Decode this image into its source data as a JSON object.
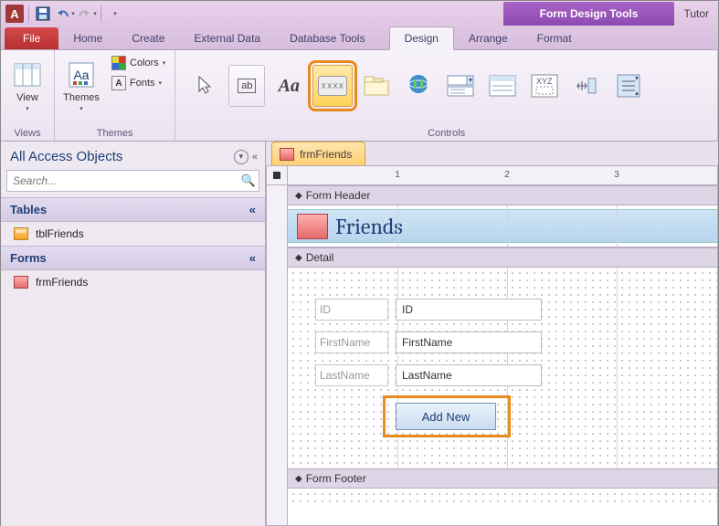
{
  "titlebar": {
    "app_letter": "A",
    "context_title": "Form Design Tools",
    "right_text": "Tutor"
  },
  "tabs": {
    "file": "File",
    "items": [
      "Home",
      "Create",
      "External Data",
      "Database Tools"
    ],
    "context": [
      "Design",
      "Arrange",
      "Format"
    ],
    "active_context_index": 0
  },
  "ribbon": {
    "views": {
      "label": "Views",
      "btn": "View"
    },
    "themes": {
      "label": "Themes",
      "btn": "Themes",
      "colors": "Colors",
      "fonts": "Fonts"
    },
    "controls": {
      "label": "Controls",
      "xxxx": "XXXX",
      "ab": "ab",
      "Aa": "Aa"
    }
  },
  "nav": {
    "title": "All Access Objects",
    "search_placeholder": "Search...",
    "sections": [
      {
        "name": "Tables",
        "items": [
          {
            "label": "tblFriends",
            "icon": "table"
          }
        ]
      },
      {
        "name": "Forms",
        "items": [
          {
            "label": "frmFriends",
            "icon": "form"
          }
        ]
      }
    ]
  },
  "doc": {
    "tab_label": "frmFriends",
    "ruler_marks": [
      1,
      2,
      3
    ],
    "sections": {
      "header": {
        "label": "Form Header",
        "title": "Friends"
      },
      "detail": {
        "label": "Detail",
        "fields": [
          {
            "label": "ID",
            "control": "ID"
          },
          {
            "label": "FirstName",
            "control": "FirstName"
          },
          {
            "label": "LastName",
            "control": "LastName"
          }
        ],
        "button": "Add New"
      },
      "footer": {
        "label": "Form Footer"
      }
    }
  }
}
